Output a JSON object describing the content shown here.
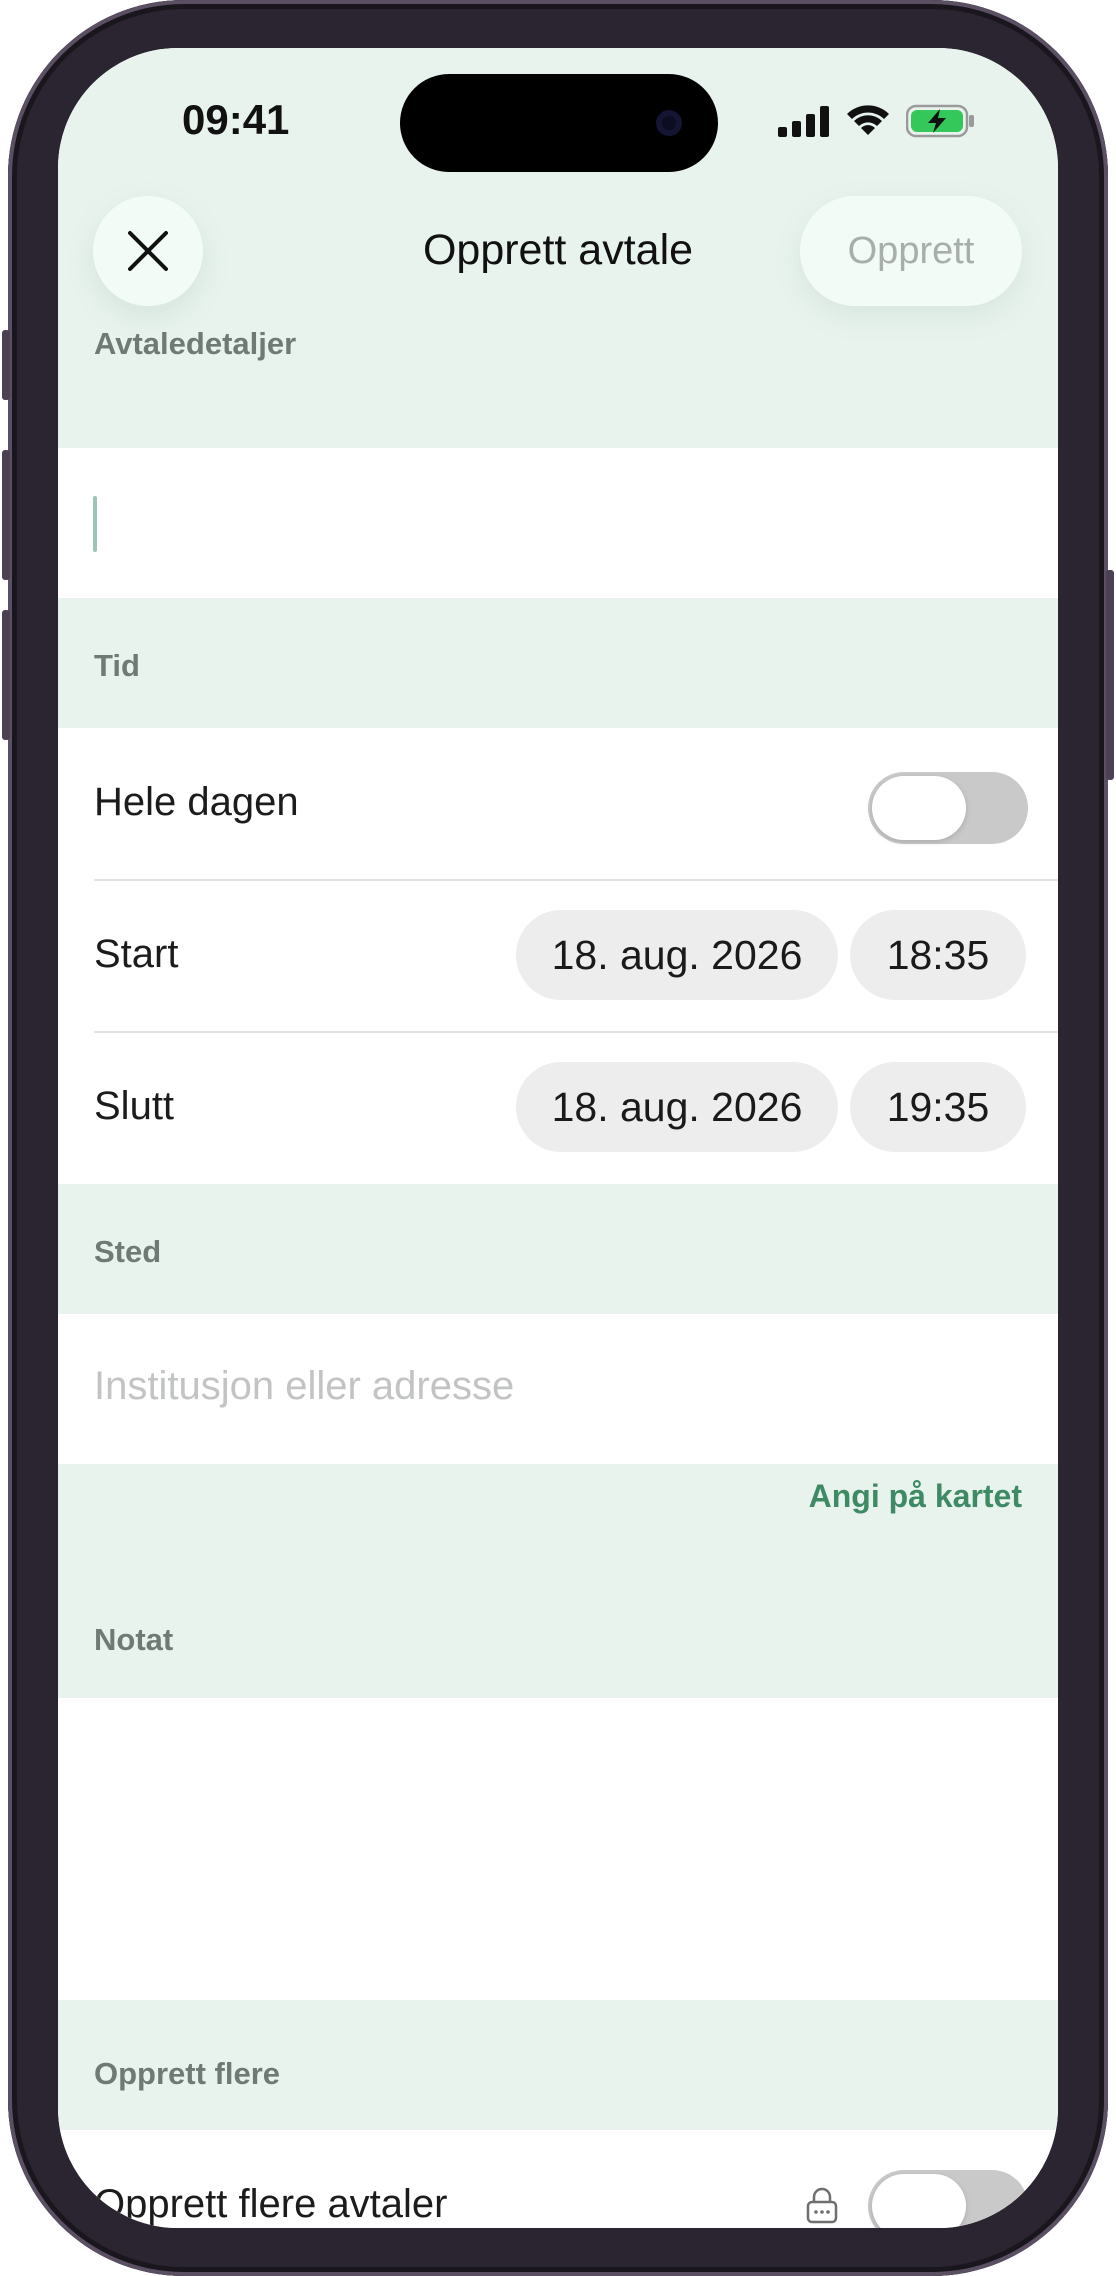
{
  "status_bar": {
    "time": "09:41",
    "icons": [
      "signal-icon",
      "wifi-icon",
      "battery-charging-icon"
    ]
  },
  "header": {
    "title": "Opprett avtale",
    "close_icon": "close-icon",
    "create_label": "Opprett"
  },
  "sections": {
    "details": {
      "label": "Avtaledetaljer",
      "title_value": ""
    },
    "time": {
      "label": "Tid",
      "all_day_label": "Hele dagen",
      "all_day_on": false,
      "start_label": "Start",
      "start_date": "18. aug. 2026",
      "start_time": "18:35",
      "end_label": "Slutt",
      "end_date": "18. aug. 2026",
      "end_time": "19:35"
    },
    "place": {
      "label": "Sted",
      "placeholder": "Institusjon eller adresse",
      "map_link": "Angi på kartet"
    },
    "note": {
      "label": "Notat",
      "value": ""
    },
    "create_more": {
      "label": "Opprett flere",
      "toggle_label": "Opprett flere avtaler",
      "toggle_on": false,
      "lock_icon": "lock-icon"
    }
  },
  "colors": {
    "section_bg": "#e9f3ee",
    "accent_green": "#3e8a64",
    "toggle_off": "#c9c9c9"
  }
}
